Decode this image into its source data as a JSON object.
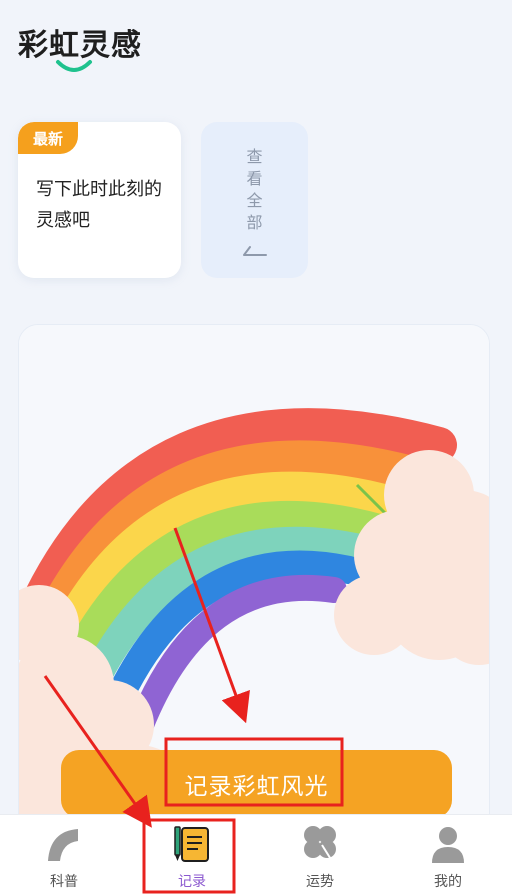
{
  "header": {
    "title": "彩虹灵感"
  },
  "latest_card": {
    "badge": "最新",
    "text": "写下此时此刻的灵感吧"
  },
  "view_all_card": {
    "label": "查看全部"
  },
  "banner": {
    "button_label": "记录彩虹风光"
  },
  "bottom_nav": {
    "items": [
      {
        "label": "科普",
        "icon": "rainbow-arc-icon"
      },
      {
        "label": "记录",
        "icon": "notebook-pencil-icon",
        "active": true
      },
      {
        "label": "运势",
        "icon": "clover-icon"
      },
      {
        "label": "我的",
        "icon": "user-icon"
      }
    ]
  },
  "colors": {
    "accent_orange": "#f5a323",
    "title_smile": "#1fc28e",
    "active_nav": "#8c5ad0",
    "annotation_red": "#e8221e"
  }
}
